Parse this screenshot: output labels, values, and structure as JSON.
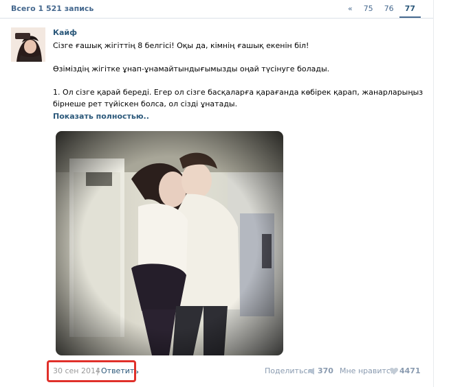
{
  "wall": {
    "total": "Всего 1 521 запись",
    "pages": [
      "«",
      "75",
      "76",
      "77"
    ],
    "current_page": "77"
  },
  "post": {
    "author": "Кайф",
    "paragraphs": [
      "Сізге ғашық жігіттің 8 белгісі! Оқы да, кімнің ғашық екенін біл!",
      "Өзіміздің жігітке ұнап-ұнамайтындығымызды оңай түсінуге болады.",
      "1. Ол сізге қарай береді. Егер ол сізге басқаларға қарағанда көбірек қарап, жанарларыңыз бірнеше рет түйіскен болса, ол сізді ұнатады."
    ],
    "show_more": "Показать полностью..",
    "date": "30 сен 2014",
    "separator": "|",
    "reply": "Ответить",
    "share_label": "Поделиться",
    "share_count": "370",
    "like_label": "Мне нравится",
    "like_count": "4471"
  },
  "colors": {
    "link": "#2b587a",
    "muted": "#999999",
    "highlight": "#e0302a"
  },
  "icons": {
    "share": "megaphone-icon",
    "like": "heart-icon"
  }
}
